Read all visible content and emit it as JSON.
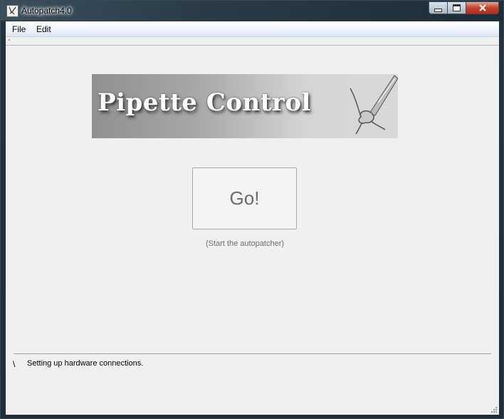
{
  "window": {
    "title": "Autopatch4.0",
    "icon": "app-icon"
  },
  "menu": {
    "items": [
      {
        "label": "File"
      },
      {
        "label": "Edit"
      }
    ]
  },
  "banner": {
    "title": "Pipette Control",
    "icon": "pipette-cell-illustration"
  },
  "main": {
    "go_label": "Go!",
    "go_hint": "(Start the autopatcher)"
  },
  "status": {
    "spinner": "\\",
    "message": "Setting up hardware connections."
  }
}
